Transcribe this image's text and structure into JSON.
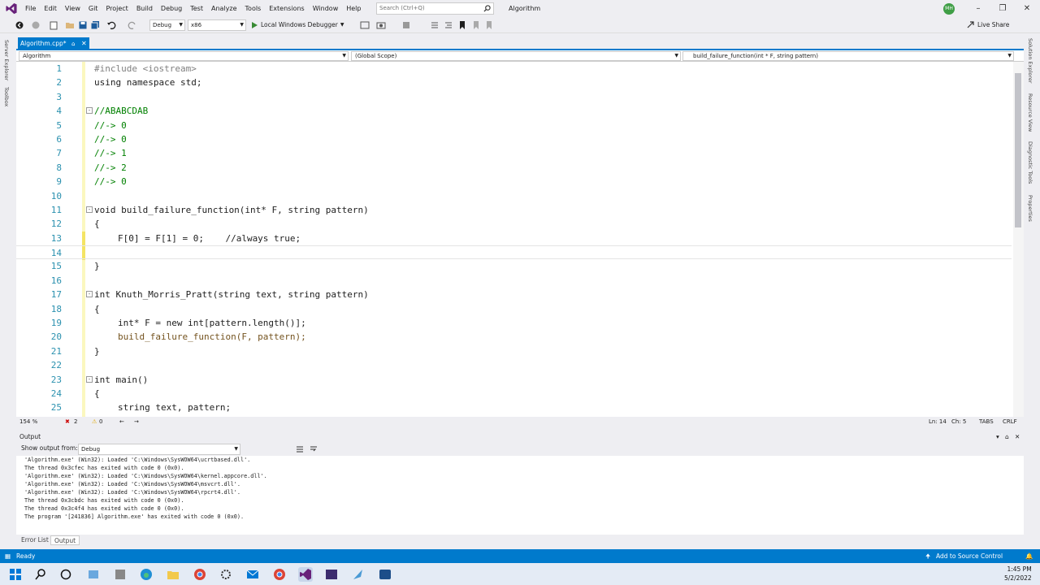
{
  "window": {
    "title": "Algorithm",
    "avatar": "MH"
  },
  "menu": {
    "items": [
      "File",
      "Edit",
      "View",
      "Git",
      "Project",
      "Build",
      "Debug",
      "Test",
      "Analyze",
      "Tools",
      "Extensions",
      "Window",
      "Help"
    ]
  },
  "search": {
    "placeholder": "Search (Ctrl+Q)"
  },
  "toolbar": {
    "config": "Debug",
    "platform": "x86",
    "run_label": "Local Windows Debugger",
    "live_share": "Live Share"
  },
  "side_tabs": {
    "left": [
      "Server Explorer",
      "Toolbox"
    ],
    "right": [
      "Solution Explorer",
      "Resource View",
      "Diagnostic Tools",
      "Properties"
    ]
  },
  "tabs": [
    {
      "label": "Algorithm.cpp*"
    }
  ],
  "navbar": {
    "project": "Algorithm",
    "scope": "(Global Scope)",
    "member": "build_failure_function(int * F, string pattern)"
  },
  "editor": {
    "lines": [
      {
        "n": "1",
        "text": "#include <iostream>"
      },
      {
        "n": "2",
        "text": "using namespace std;"
      },
      {
        "n": "3",
        "text": ""
      },
      {
        "n": "4",
        "text": "//ABABCDAB"
      },
      {
        "n": "5",
        "text": "//-> 0"
      },
      {
        "n": "6",
        "text": "//-> 0"
      },
      {
        "n": "7",
        "text": "//-> 1"
      },
      {
        "n": "8",
        "text": "//-> 2"
      },
      {
        "n": "9",
        "text": "//-> 0"
      },
      {
        "n": "10",
        "text": ""
      },
      {
        "n": "11",
        "text": "void build_failure_function(int* F, string pattern)"
      },
      {
        "n": "12",
        "text": "{"
      },
      {
        "n": "13",
        "text": "F[0] = F[1] = 0;    //always true;"
      },
      {
        "n": "14",
        "text": ""
      },
      {
        "n": "15",
        "text": "}"
      },
      {
        "n": "16",
        "text": ""
      },
      {
        "n": "17",
        "text": "int Knuth_Morris_Pratt(string text, string pattern)"
      },
      {
        "n": "18",
        "text": "{"
      },
      {
        "n": "19",
        "text": "int* F = new int[pattern.length()];"
      },
      {
        "n": "20",
        "text": "build_failure_function(F, pattern);"
      },
      {
        "n": "21",
        "text": "}"
      },
      {
        "n": "22",
        "text": ""
      },
      {
        "n": "23",
        "text": "int main()"
      },
      {
        "n": "24",
        "text": "{"
      },
      {
        "n": "25",
        "text": "string text, pattern;"
      }
    ]
  },
  "status_line": {
    "zoom": "154 %",
    "errors": "2",
    "warnings": "0",
    "ln": "Ln: 14",
    "ch": "Ch: 5",
    "tabs": "TABS",
    "crlf": "CRLF"
  },
  "output": {
    "title": "Output",
    "show_from_label": "Show output from:",
    "source": "Debug",
    "lines": [
      "'Algorithm.exe' (Win32): Loaded 'C:\\Windows\\SysWOW64\\ucrtbased.dll'.",
      "The thread 0x3cfec has exited with code 0 (0x0).",
      "'Algorithm.exe' (Win32): Loaded 'C:\\Windows\\SysWOW64\\kernel.appcore.dll'.",
      "'Algorithm.exe' (Win32): Loaded 'C:\\Windows\\SysWOW64\\msvcrt.dll'.",
      "'Algorithm.exe' (Win32): Loaded 'C:\\Windows\\SysWOW64\\rpcrt4.dll'.",
      "The thread 0x3cbdc has exited with code 0 (0x0).",
      "The thread 0x3c4f4 has exited with code 0 (0x0).",
      "The program '[241836] Algorithm.exe' has exited with code 0 (0x0)."
    ]
  },
  "bottom_tabs": [
    "Error List",
    "Output"
  ],
  "statusbar": {
    "left": "Ready",
    "right": "Add to Source Control"
  },
  "taskbar": {
    "time": "1:45 PM",
    "date": "5/2/2022"
  },
  "colors": {
    "accent": "#007acc",
    "keyword": "#0000ff",
    "comment": "#008000",
    "type": "#2b91af"
  }
}
